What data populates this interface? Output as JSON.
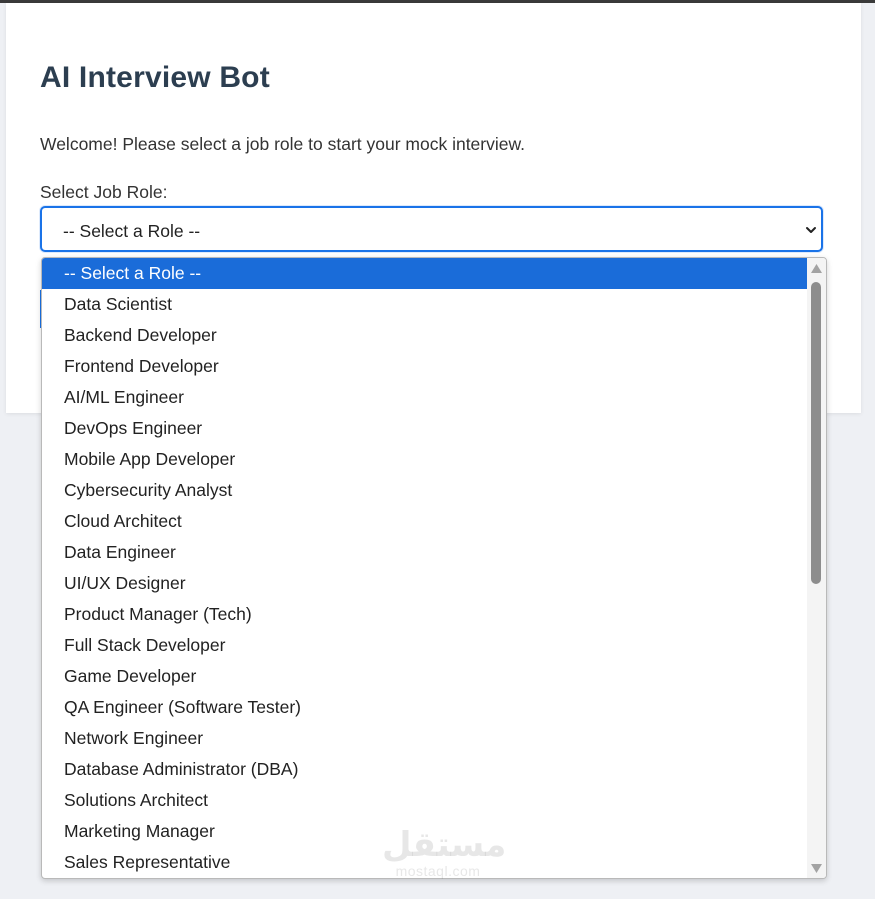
{
  "page": {
    "title": "AI Interview Bot",
    "intro": "Welcome! Please select a job role to start your mock interview."
  },
  "role_select": {
    "label": "Select Job Role:",
    "current_value": "-- Select a Role --",
    "options": [
      "-- Select a Role --",
      "Data Scientist",
      "Backend Developer",
      "Frontend Developer",
      "AI/ML Engineer",
      "DevOps Engineer",
      "Mobile App Developer",
      "Cybersecurity Analyst",
      "Cloud Architect",
      "Data Engineer",
      "UI/UX Designer",
      "Product Manager (Tech)",
      "Full Stack Developer",
      "Game Developer",
      "QA Engineer (Software Tester)",
      "Network Engineer",
      "Database Administrator (DBA)",
      "Solutions Architect",
      "Marketing Manager",
      "Sales Representative"
    ],
    "highlighted_index": 0
  },
  "watermark": {
    "logo_text": "مستقل",
    "domain": "mostaql.com"
  },
  "colors": {
    "accent": "#1a73e8",
    "highlight": "#1a6cd9",
    "title": "#2c3e50",
    "background": "#eef0f4"
  },
  "icons": {
    "select_arrow": "chevron-down-icon",
    "scroll_up": "triangle-up-icon",
    "scroll_down": "triangle-down-icon"
  }
}
